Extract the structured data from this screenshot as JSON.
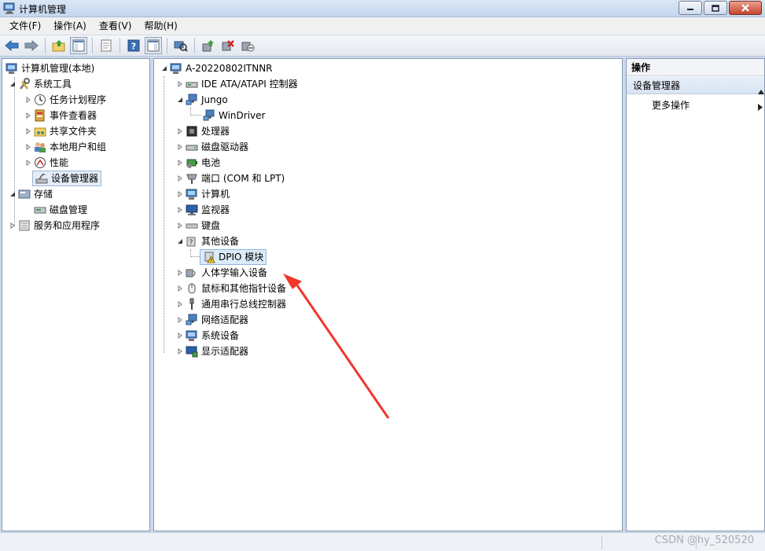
{
  "window": {
    "title": "计算机管理"
  },
  "menu": [
    "文件(F)",
    "操作(A)",
    "查看(V)",
    "帮助(H)"
  ],
  "toolbar": {
    "icons": [
      "back-icon",
      "forward-icon",
      "up-folder-icon",
      "show-hide-tree-icon",
      "properties-icon",
      "help-icon",
      "show-hide-action-pane-icon",
      "scan-hardware-icon",
      "update-driver-icon",
      "uninstall-icon",
      "disable-device-icon"
    ]
  },
  "left_tree": {
    "root": "计算机管理(本地)",
    "items": [
      {
        "label": "系统工具"
      },
      {
        "label": "任务计划程序"
      },
      {
        "label": "事件查看器"
      },
      {
        "label": "共享文件夹"
      },
      {
        "label": "本地用户和组"
      },
      {
        "label": "性能"
      },
      {
        "label": "设备管理器"
      },
      {
        "label": "存储"
      },
      {
        "label": "磁盘管理"
      },
      {
        "label": "服务和应用程序"
      }
    ]
  },
  "device_tree": {
    "root": "A-20220802ITNNR",
    "items": [
      {
        "label": "IDE ATA/ATAPI 控制器"
      },
      {
        "label": "Jungo"
      },
      {
        "label": "WinDriver"
      },
      {
        "label": "处理器"
      },
      {
        "label": "磁盘驱动器"
      },
      {
        "label": "电池"
      },
      {
        "label": "端口 (COM 和 LPT)"
      },
      {
        "label": "计算机"
      },
      {
        "label": "监视器"
      },
      {
        "label": "键盘"
      },
      {
        "label": "其他设备"
      },
      {
        "label": "DPIO 模块"
      },
      {
        "label": "人体学输入设备"
      },
      {
        "label": "鼠标和其他指针设备"
      },
      {
        "label": "通用串行总线控制器"
      },
      {
        "label": "网络适配器"
      },
      {
        "label": "系统设备"
      },
      {
        "label": "显示适配器"
      }
    ]
  },
  "actions": {
    "header": "操作",
    "group": "设备管理器",
    "more": "更多操作"
  },
  "status": {
    "watermark": "CSDN @hy_520520"
  },
  "colors": {
    "annotation_arrow": "#f0362a",
    "selection": "#dcebfa"
  }
}
